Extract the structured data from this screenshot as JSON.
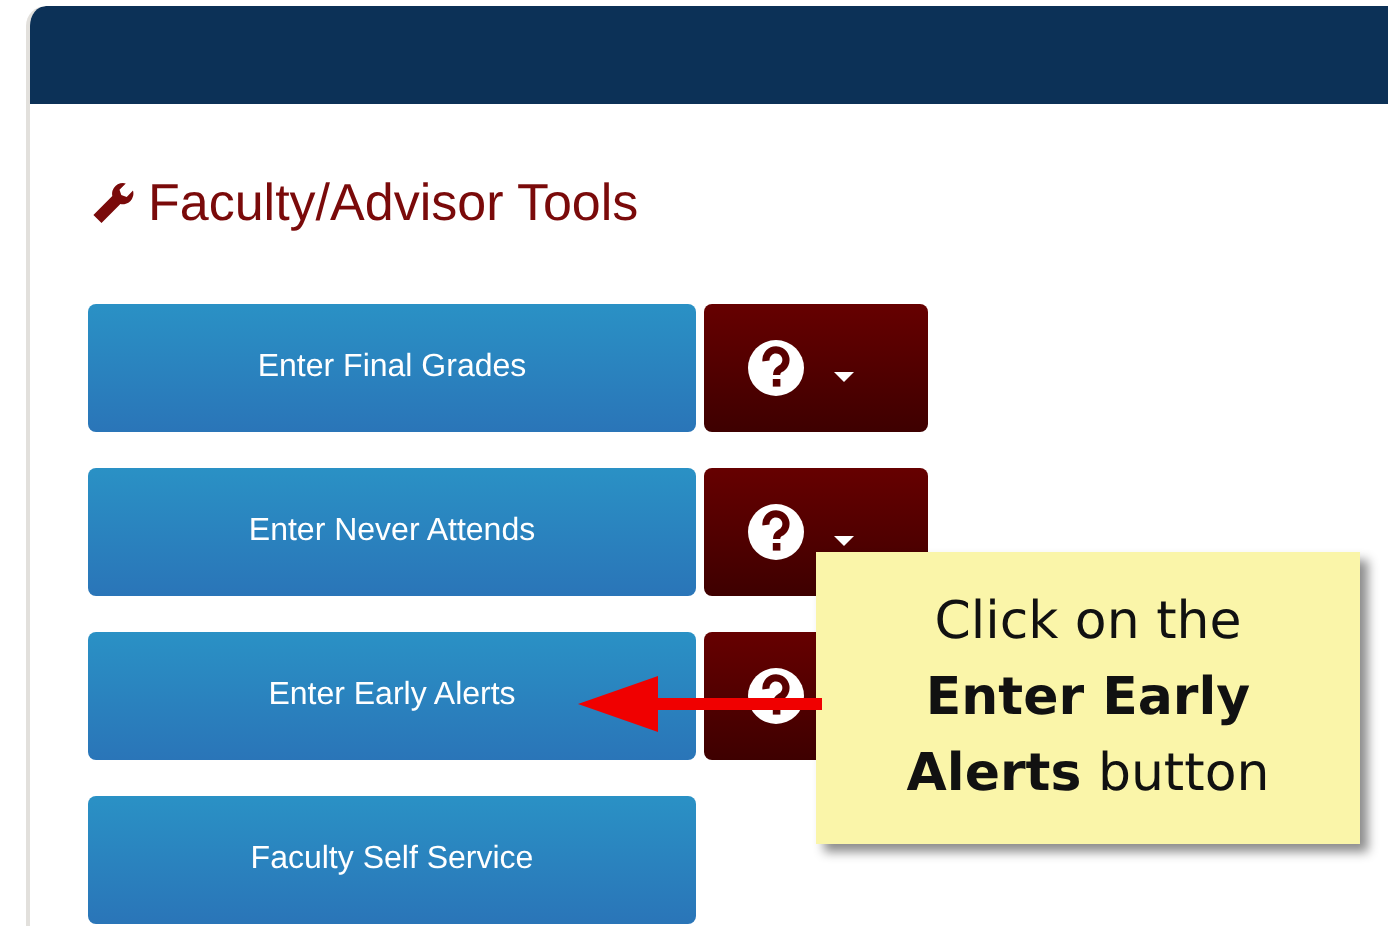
{
  "panel": {
    "title": "Faculty/Advisor Tools"
  },
  "tools": [
    {
      "label": "Enter Final Grades",
      "kind": "split"
    },
    {
      "label": "Enter Never Attends",
      "kind": "split"
    },
    {
      "label": "Enter Early Alerts",
      "kind": "help"
    },
    {
      "label": "Faculty Self Service",
      "kind": "single"
    }
  ],
  "callout": {
    "text": "Click on the **Enter Early Alerts** button"
  }
}
